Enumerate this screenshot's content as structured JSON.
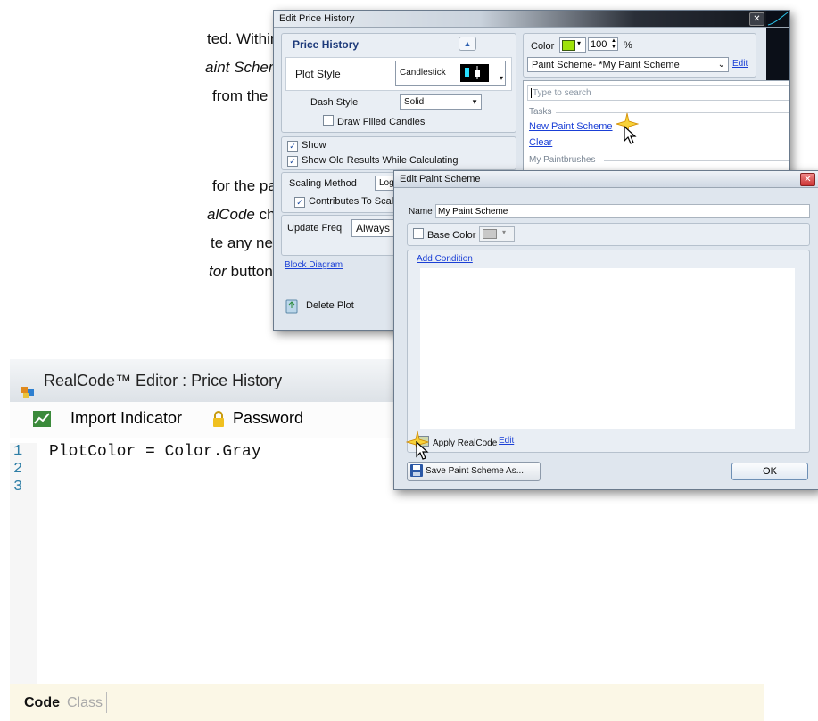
{
  "doc_text": {
    "l1a": "ted.  Within the",
    "l2a": "aint Scheme drop-",
    "l3a": "from the menu",
    "l4a": "for the paint",
    "l5a": "alCode",
    "l5b": " check box.",
    "l6a": "te any necessary",
    "l7a": "tor",
    "l7b": " button.  Then"
  },
  "edit_price_history": {
    "title": "Edit Price History",
    "heading": "Price History",
    "plot_style_label": "Plot Style",
    "plot_style_value": "Candlestick",
    "dash_style_label": "Dash Style",
    "dash_style_value": "Solid",
    "draw_filled_candles": "Draw Filled Candles",
    "show": "Show",
    "show_old_results": "Show Old Results While Calculating",
    "scaling_method_label": "Scaling Method",
    "scaling_method_value": "Log",
    "contributes_to_scale": "Contributes To Scal",
    "update_freq_label": "Update Freq",
    "update_freq_value": "Always",
    "block_diagram": "Block Diagram",
    "delete_plot": "Delete Plot",
    "color_label": "Color",
    "opacity_value": "100",
    "opacity_unit": "%",
    "paint_scheme_combo": "Paint Scheme-  *My Paint Scheme",
    "edit_link": "Edit",
    "search_placeholder": "Type to search",
    "tasks_header": "Tasks",
    "new_paint_scheme": "New Paint Scheme",
    "clear": "Clear",
    "my_paintbrushes": "My Paintbrushes"
  },
  "edit_paint_scheme": {
    "title": "Edit Paint Scheme",
    "name_label": "Name",
    "name_value": "My Paint Scheme",
    "base_color": "Base Color",
    "add_condition": "Add Condition",
    "apply_realcode": "Apply RealCode",
    "apply_edit": "Edit",
    "save_as": "Save Paint Scheme As...",
    "ok": "OK"
  },
  "realcode_editor": {
    "title": "RealCode™ Editor : Price History",
    "import_indicator": "Import Indicator",
    "password": "Password",
    "line_numbers": [
      "1",
      "2",
      "3"
    ],
    "code_line_1": "PlotColor = Color.Gray",
    "tab_code": "Code",
    "tab_class": "Class"
  },
  "colors": {
    "accent_link": "#1a3fd6",
    "paint_swatch": "#9fe20a",
    "line_number": "#2e7ea6"
  }
}
